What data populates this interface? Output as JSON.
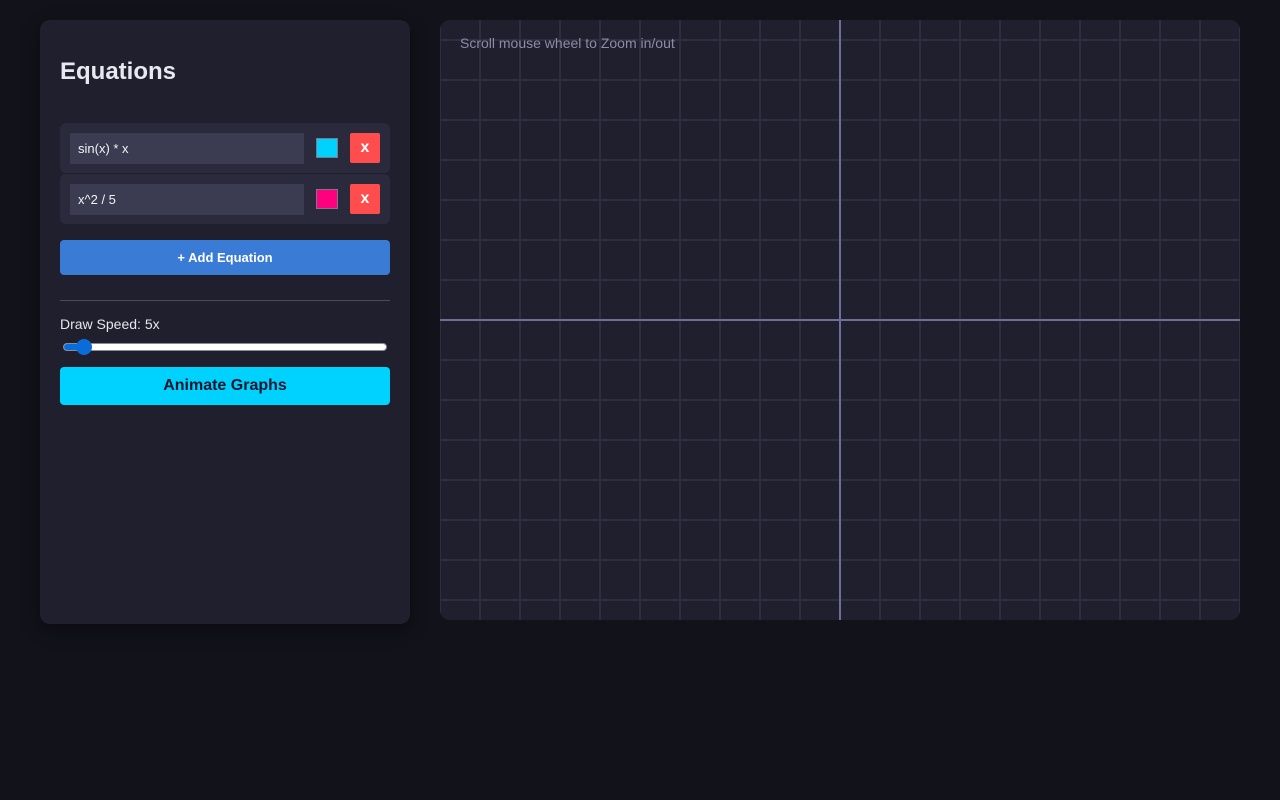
{
  "sidebar": {
    "title": "Equations",
    "equations": [
      {
        "expression": "sin(x) * x",
        "color": "#00d2ff",
        "remove_label": "x"
      },
      {
        "expression": "x^2 / 5",
        "color": "#ff007f",
        "remove_label": "x"
      }
    ],
    "add_label": "+ Add Equation",
    "speed_label": "Draw Speed: 5x",
    "speed": {
      "value": 5,
      "min": 1,
      "max": 100
    },
    "animate_label": "Animate Graphs"
  },
  "graph": {
    "hint": "Scroll mouse wheel to Zoom in/out",
    "grid_color": "#2e2e40",
    "axis_color": "#6e6e9a",
    "background": "#1f1f2e"
  }
}
